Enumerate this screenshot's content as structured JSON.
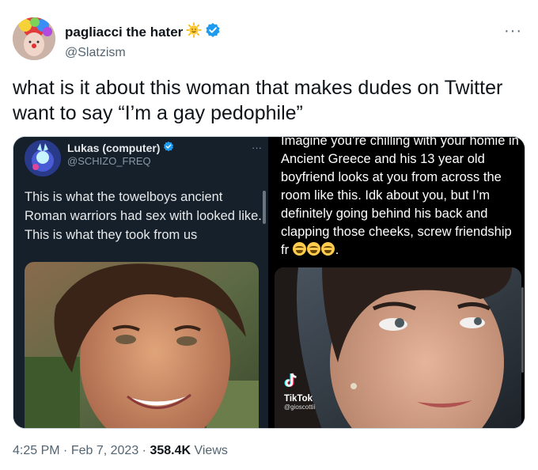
{
  "author": {
    "display_name": "pagliacci the hater",
    "handle": "@Slatzism",
    "badge_icon": "sun-emoji-icon",
    "verified_icon": "verified-badge-icon",
    "verified_color": "#1d9bf0"
  },
  "more_icon": "more-options-icon",
  "tweet": {
    "text": "what is it about this woman that makes dudes on Twitter want to say “I’m a gay pedophile”"
  },
  "media": {
    "left": {
      "author_name": "Lukas (computer)",
      "author_handle": "@SCHIZO_FREQ",
      "verified_icon": "verified-badge-icon",
      "body": "This is what the towelboys ancient Roman warriors had sex with looked like. This is what they took from us"
    },
    "right": {
      "body": "Imagine you’re chilling with your homie in Ancient Greece and his 13 year old boyfriend looks at you from across the room like this. Idk about you, but I’m definitely going behind his back and clapping those cheeks, screw friendship fr",
      "body_end": ".",
      "emoji_icon": "tears-of-joy-emoji-icon",
      "tiktok_label": "TikTok",
      "tiktok_user": "@gioscottii"
    }
  },
  "meta": {
    "time": "4:25 PM",
    "sep1": " · ",
    "date": "Feb 7, 2023",
    "sep2": " · ",
    "views_count": "358.4K",
    "views_label": " Views"
  },
  "colors": {
    "text": "#0f1419",
    "secondary": "#536471",
    "dark_panel": "#15202b"
  }
}
